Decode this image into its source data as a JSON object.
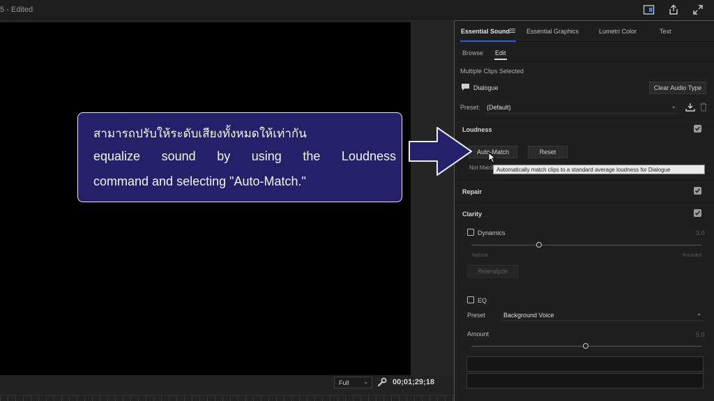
{
  "window": {
    "title": "5 - Edited"
  },
  "topbar_icons": [
    "panel-layout-icon",
    "share-export-icon",
    "fullscreen-icon"
  ],
  "monitor": {
    "resolution": "Full",
    "timecode": "00;01;29;18"
  },
  "panel": {
    "tabs": [
      {
        "label": "Essential Sound",
        "active": true
      },
      {
        "label": "Essential Graphics"
      },
      {
        "label": "Lumetri Color"
      },
      {
        "label": "Text"
      }
    ],
    "subtabs": [
      {
        "label": "Browse"
      },
      {
        "label": "Edit",
        "active": true
      }
    ],
    "selection_info": "Multiple Clips Selected",
    "audio_type": "Dialogue",
    "clear_audio_type": "Clear Audio Type",
    "preset_label": "Preset:",
    "preset_value": "(Default)",
    "loudness": {
      "title": "Loudness",
      "checked": true,
      "auto_match": "Auto-Match",
      "reset": "Reset",
      "status": "Not Match"
    },
    "tooltip": "Automatically match clips to a standard average loudness for Dialogue",
    "repair": {
      "title": "Repair",
      "checked": true
    },
    "clarity": {
      "title": "Clarity",
      "checked": true,
      "dynamics": {
        "label": "Dynamics",
        "value": "3.0",
        "min_label": "Natural",
        "max_label": "Focused",
        "level": 0.3,
        "reanalyze": "Reanalyze"
      },
      "eq": {
        "label": "EQ",
        "preset_label": "Preset",
        "preset_value": "Background Voice",
        "amount_label": "Amount",
        "amount_value": "5.0",
        "level": 0.5
      }
    }
  },
  "callout": {
    "line1": "สามารถปรับให้ระดับเสียงทั้งหมดให้เท่ากัน",
    "line2_words": [
      "equalize",
      "sound",
      "by",
      "using",
      "the",
      "Loudness"
    ],
    "line3": "command and selecting \"Auto-Match.\""
  },
  "colors": {
    "callout_bg": "#24206a",
    "panel_accent": "#3b4fb3",
    "tab_underline": "#2f5fe0"
  }
}
